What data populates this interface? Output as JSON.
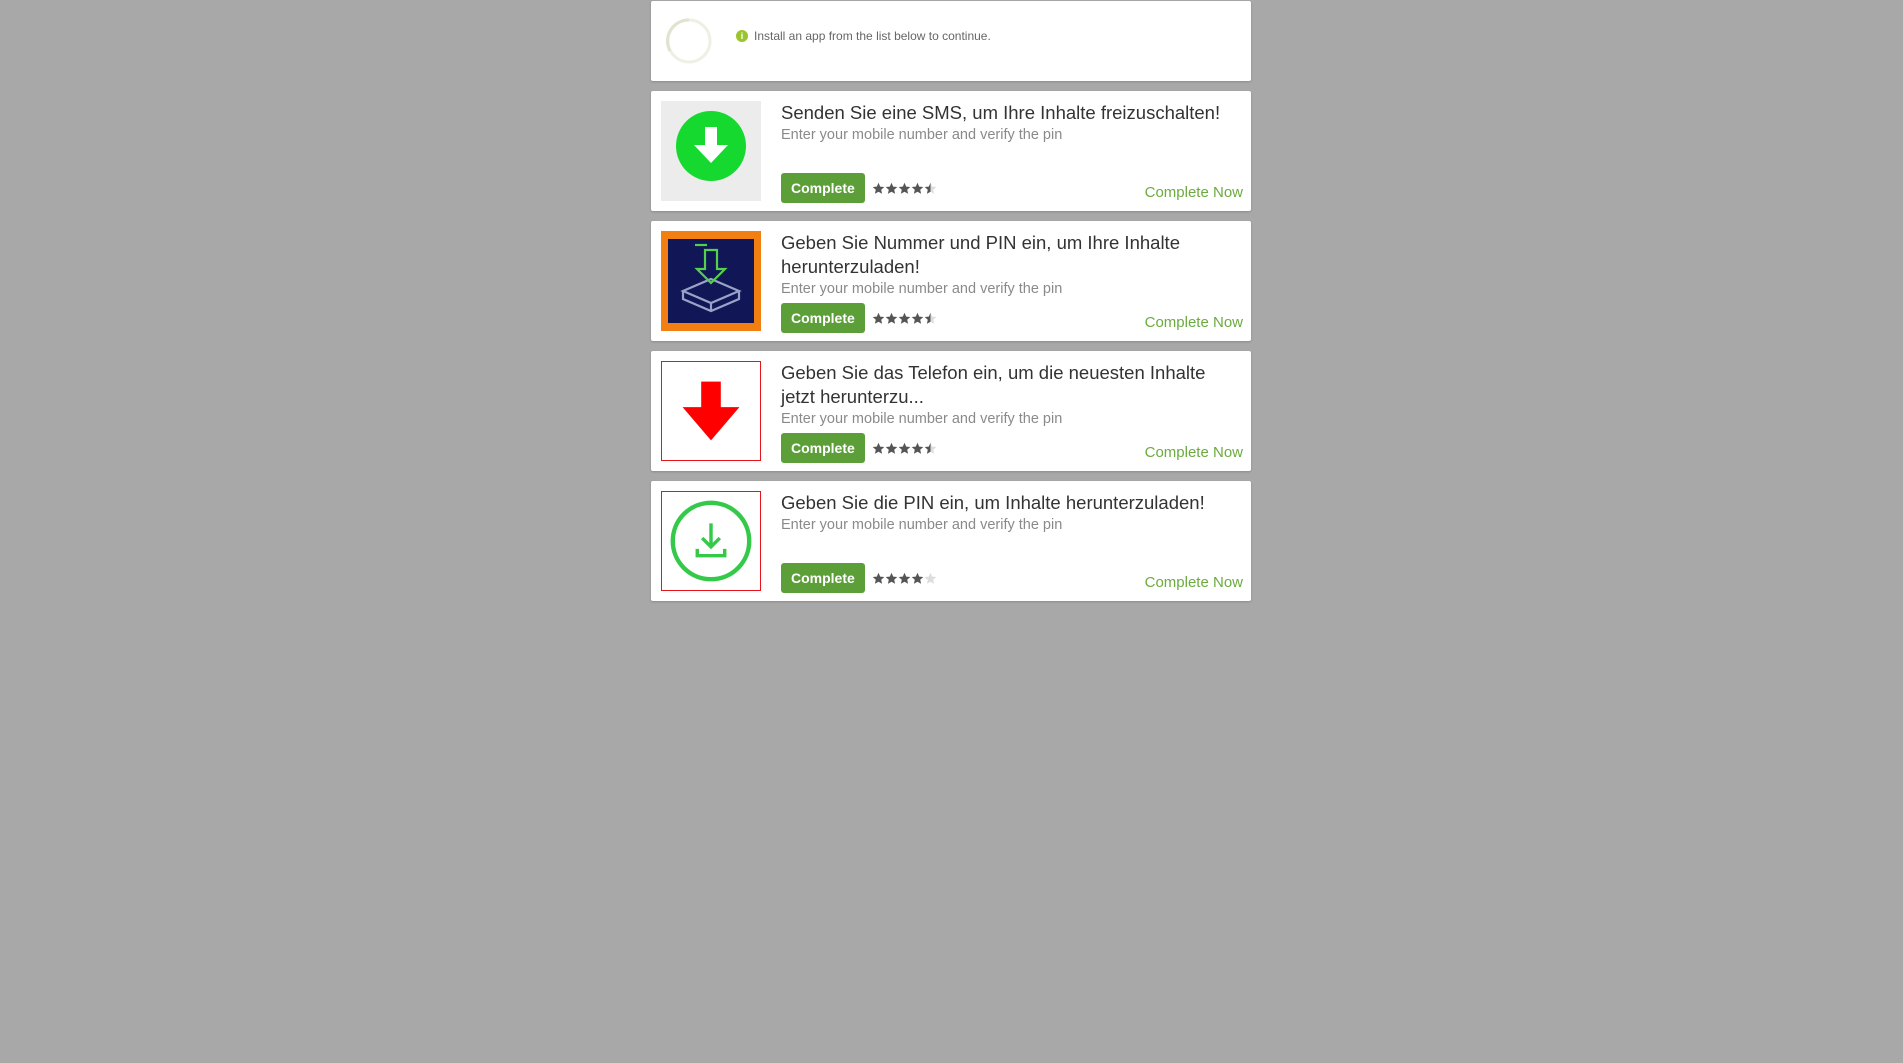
{
  "status": {
    "message": "Install an app from the list below to continue.",
    "info_icon_glyph": "i"
  },
  "offers": [
    {
      "title": "Senden Sie eine SMS, um Ihre Inhalte freizuschalten!",
      "subtitle": "Enter your mobile number and verify the pin",
      "button_label": "Complete",
      "link_label": "Complete Now",
      "rating": 4.5,
      "icon": "green-circle-download-arrow-icon"
    },
    {
      "title": "Geben Sie Nummer und PIN ein, um Ihre Inhalte herunterzuladen!",
      "subtitle": "Enter your mobile number and verify the pin",
      "button_label": "Complete",
      "link_label": "Complete Now",
      "rating": 4.5,
      "icon": "inbox-download-icon"
    },
    {
      "title": "Geben Sie das Telefon ein, um die neuesten Inhalte jetzt herunterzu...",
      "subtitle": "Enter your mobile number and verify the pin",
      "button_label": "Complete",
      "link_label": "Complete Now",
      "rating": 4.5,
      "icon": "red-down-arrow-icon"
    },
    {
      "title": "Geben Sie die PIN ein, um Inhalte herunterzuladen!",
      "subtitle": "Enter your mobile number and verify the pin",
      "button_label": "Complete",
      "link_label": "Complete Now",
      "rating": 4,
      "icon": "green-ring-download-icon"
    }
  ],
  "colors": {
    "background": "#a8a8a8",
    "button": "#5c9f38",
    "link": "#6cab3f",
    "star": "#555555",
    "star_empty": "#dddddd"
  }
}
